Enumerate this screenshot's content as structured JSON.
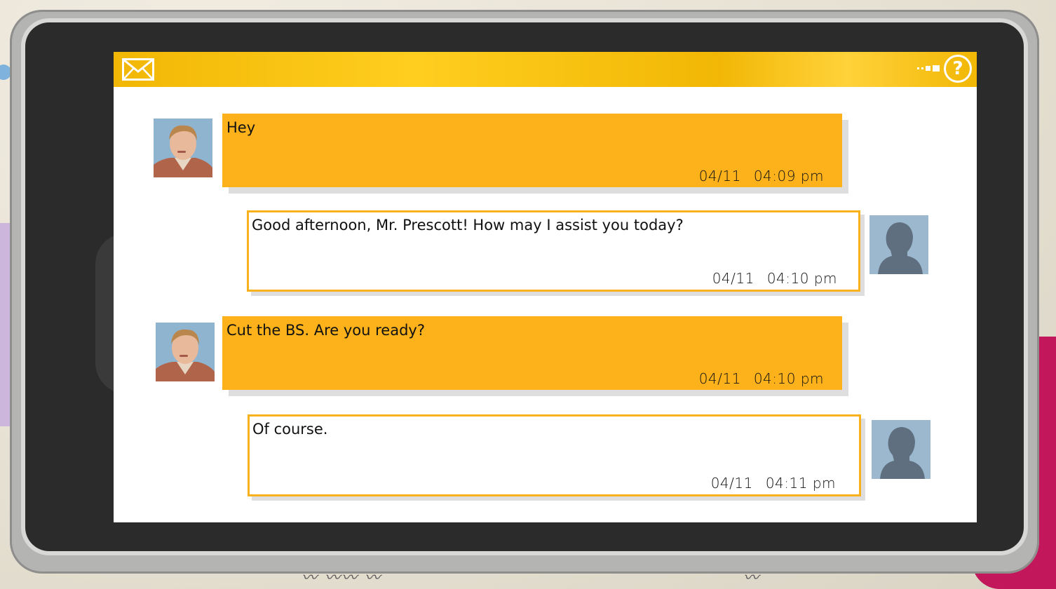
{
  "header": {
    "mail_icon": "mail-icon",
    "signal_icon": "signal-icon",
    "help_label": "?"
  },
  "colors": {
    "accent": "#fdb21b",
    "header": "#f2b705",
    "outgoing_border": "#f9b21c"
  },
  "messages": [
    {
      "sender": "contact",
      "text": "Hey",
      "date": "04/11",
      "time": "04:09 pm"
    },
    {
      "sender": "self",
      "text": "Good afternoon, Mr. Prescott!  How may I assist you today?",
      "date": "04/11",
      "time": "04:10 pm"
    },
    {
      "sender": "contact",
      "text": "Cut the BS.  Are you ready?",
      "date": "04/11",
      "time": "04:10 pm"
    },
    {
      "sender": "self",
      "text": "Of course.",
      "date": "04/11",
      "time": "04:11 pm"
    }
  ]
}
